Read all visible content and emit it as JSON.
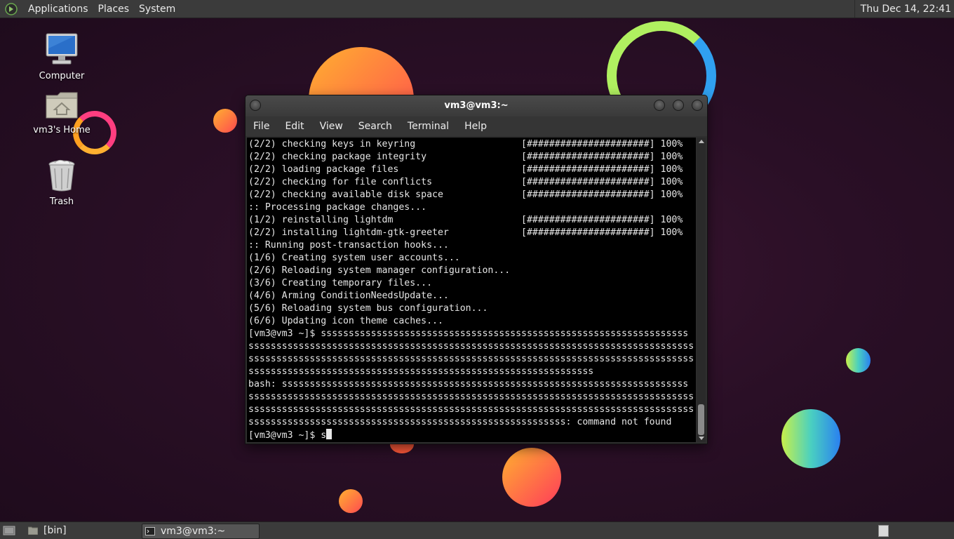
{
  "top_panel": {
    "applications": "Applications",
    "places": "Places",
    "system": "System",
    "clock": "Thu Dec 14, 22:41"
  },
  "desktop_icons": [
    {
      "label": "Computer",
      "icon": "computer-icon"
    },
    {
      "label": "vm3's Home",
      "icon": "home-folder-icon"
    },
    {
      "label": "Trash",
      "icon": "trash-icon"
    }
  ],
  "terminal": {
    "title": "vm3@vm3:~",
    "menu": [
      "File",
      "Edit",
      "View",
      "Search",
      "Terminal",
      "Help"
    ],
    "lines": [
      "(2/2) checking keys in keyring                   [######################] 100%",
      "(2/2) checking package integrity                 [######################] 100%",
      "(2/2) loading package files                      [######################] 100%",
      "(2/2) checking for file conflicts                [######################] 100%",
      "(2/2) checking available disk space              [######################] 100%",
      ":: Processing package changes...",
      "(1/2) reinstalling lightdm                       [######################] 100%",
      "(2/2) installing lightdm-gtk-greeter             [######################] 100%",
      ":: Running post-transaction hooks...",
      "(1/6) Creating system user accounts...",
      "(2/6) Reloading system manager configuration...",
      "(3/6) Creating temporary files...",
      "(4/6) Arming ConditionNeedsUpdate...",
      "(5/6) Reloading system bus configuration...",
      "(6/6) Updating icon theme caches...",
      "[vm3@vm3 ~]$ ssssssssssssssssssssssssssssssssssssssssssssssssssssssssssssssssss",
      "ssssssssssssssssssssssssssssssssssssssssssssssssssssssssssssssssssssssssssssssss",
      "ssssssssssssssssssssssssssssssssssssssssssssssssssssssssssssssssssssssssssssssss",
      "ssssssssssssssssssssssssssssssssssssssssssssssssssssssssssssss",
      "bash: sssssssssssssssssssssssssssssssssssssssssssssssssssssssssssssssssssssssss",
      "ssssssssssssssssssssssssssssssssssssssssssssssssssssssssssssssssssssssssssssssss",
      "ssssssssssssssssssssssssssssssssssssssssssssssssssssssssssssssssssssssssssssssss",
      "sssssssssssssssssssssssssssssssssssssssssssssssssssssssss: command not found"
    ],
    "prompt": "[vm3@vm3 ~]$ s"
  },
  "bottom_panel": {
    "tasks": [
      {
        "label": "[bin]",
        "icon": "folder-icon"
      },
      {
        "label": "vm3@vm3:~",
        "icon": "terminal-icon"
      }
    ]
  }
}
